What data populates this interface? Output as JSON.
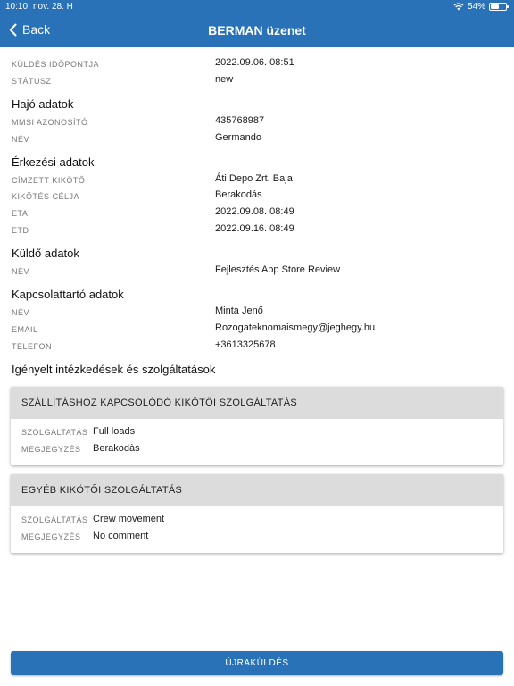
{
  "status_bar": {
    "time": "10:10",
    "date": "nov. 28. H",
    "battery": "54%",
    "battery_level": 0.54
  },
  "nav": {
    "back_label": "Back",
    "title": "BERMAN üzenet"
  },
  "meta": {
    "sent_label": "KÜLDÉS IDŐPONTJA",
    "sent_value": "2022.09.06. 08:51",
    "status_label": "STÁTUSZ",
    "status_value": "new"
  },
  "ship": {
    "title": "Hajó adatok",
    "mmsi_label": "MMSI AZONOSÍTÓ",
    "mmsi_value": "435768987",
    "name_label": "NÉV",
    "name_value": "Germando"
  },
  "arrival": {
    "title": "Érkezési adatok",
    "port_label": "CÍMZETT KIKÖTŐ",
    "port_value": "Áti Depo Zrt. Baja",
    "purpose_label": "KIKÖTÉS CÉLJA",
    "purpose_value": "Berakodás",
    "eta_label": "ETA",
    "eta_value": "2022.09.08. 08:49",
    "etd_label": "ETD",
    "etd_value": "2022.09.16. 08:49"
  },
  "sender": {
    "title": "Küldő adatok",
    "name_label": "NÉV",
    "name_value": "Fejlesztés App Store Review"
  },
  "contact": {
    "title": "Kapcsolattartó adatok",
    "name_label": "NÉV",
    "name_value": "Minta Jenő",
    "email_label": "EMAIL",
    "email_value": "Rozogateknomaismegy@jeghegy.hu",
    "phone_label": "TELEFON",
    "phone_value": "+3613325678"
  },
  "services": {
    "title": "Igényelt intézkedések és szolgáltatások",
    "cards": [
      {
        "header": "SZÁLLÍTÁSHOZ KAPCSOLÓDÓ KIKÖTŐI SZOLGÁLTATÁS",
        "service_label": "SZOLGÁLTATÁS",
        "service_value": "Full loads",
        "note_label": "MEGJEGYZÉS",
        "note_value": "Berakodàs"
      },
      {
        "header": "EGYÉB KIKÖTŐI SZOLGÁLTATÁS",
        "service_label": "SZOLGÁLTATÁS",
        "service_value": "Crew movement",
        "note_label": "MEGJEGYZÉS",
        "note_value": "No comment"
      }
    ]
  },
  "resend_label": "ÚJRAKÜLDÉS"
}
